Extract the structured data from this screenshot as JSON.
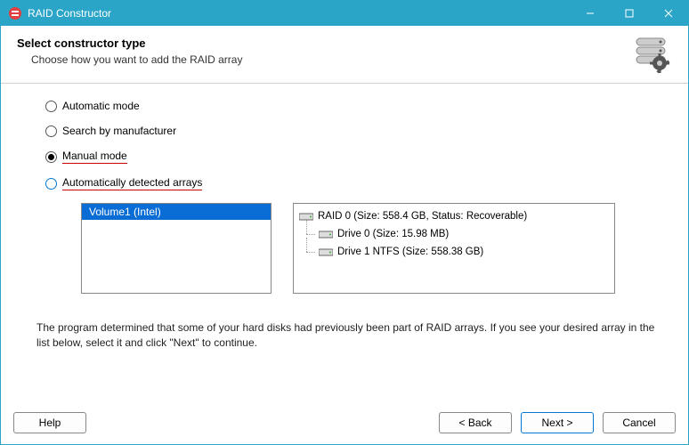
{
  "window": {
    "title": "RAID Constructor"
  },
  "header": {
    "title": "Select constructor type",
    "subtitle": "Choose how you want to add the RAID array"
  },
  "options": {
    "automatic": "Automatic mode",
    "search_mfr": "Search by manufacturer",
    "manual": "Manual mode",
    "auto_detected": "Automatically detected arrays"
  },
  "left_panel": {
    "items": [
      "Volume1 (Intel)"
    ]
  },
  "right_panel": {
    "root": "RAID 0 (Size: 558.4 GB, Status: Recoverable)",
    "children": [
      "Drive 0 (Size: 15.98 MB)",
      "Drive 1 NTFS (Size: 558.38 GB)"
    ]
  },
  "info": "The program determined that some of your hard disks had previously been part of RAID arrays. If you see your desired array in the list below, select it and click \"Next\" to continue.",
  "buttons": {
    "help": "Help",
    "back": "< Back",
    "next": "Next >",
    "cancel": "Cancel"
  }
}
